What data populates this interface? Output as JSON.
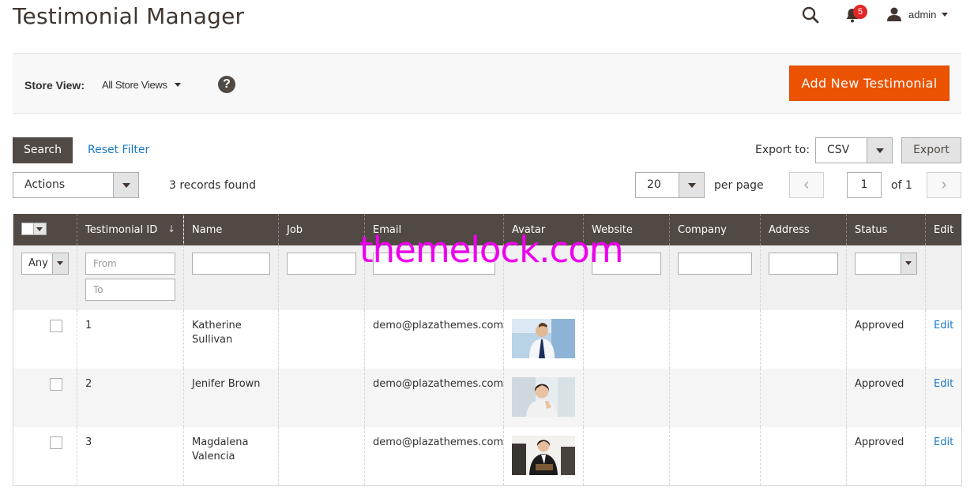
{
  "page": {
    "title": "Testimonial Manager"
  },
  "header": {
    "notifications_count": "5",
    "user_name": "admin"
  },
  "store_bar": {
    "label": "Store View:",
    "selected": "All Store Views",
    "help": "?",
    "add_button": "Add New Testimonial"
  },
  "toolbar": {
    "search_label": "Search",
    "reset_label": "Reset Filter",
    "export_label": "Export to:",
    "export_format": "CSV",
    "export_button": "Export",
    "actions_label": "Actions",
    "records_found": "3 records found",
    "per_page_value": "20",
    "per_page_label": "per page",
    "prev_glyph": "‹",
    "next_glyph": "›",
    "current_page": "1",
    "of_pages": "of 1"
  },
  "grid": {
    "columns": [
      "Testimonial ID",
      "Name",
      "Job",
      "Email",
      "Avatar",
      "Website",
      "Company",
      "Address",
      "Status",
      "Edit"
    ],
    "sort_glyph": "↓",
    "filters": {
      "any": "Any",
      "from_placeholder": "From",
      "to_placeholder": "To"
    },
    "rows": [
      {
        "id": "1",
        "name": "Katherine Sullivan",
        "job": "",
        "email": "demo@plazathemes.com",
        "avatar": "man-in-office-photo",
        "website": "",
        "company": "",
        "address": "",
        "status": "Approved",
        "edit": "Edit"
      },
      {
        "id": "2",
        "name": "Jenifer Brown",
        "job": "",
        "email": "demo@plazathemes.com",
        "avatar": "smiling-woman-photo",
        "website": "",
        "company": "",
        "address": "",
        "status": "Approved",
        "edit": "Edit"
      },
      {
        "id": "3",
        "name": "Magdalena Valencia",
        "job": "",
        "email": "demo@plazathemes.com",
        "avatar": "woman-with-folder-photo",
        "website": "",
        "company": "",
        "address": "",
        "status": "Approved",
        "edit": "Edit"
      }
    ]
  },
  "watermark": "themelock.com",
  "colors": {
    "accent": "#eb5202",
    "header_dark": "#514943",
    "link": "#1979c3",
    "badge": "#e22626"
  }
}
